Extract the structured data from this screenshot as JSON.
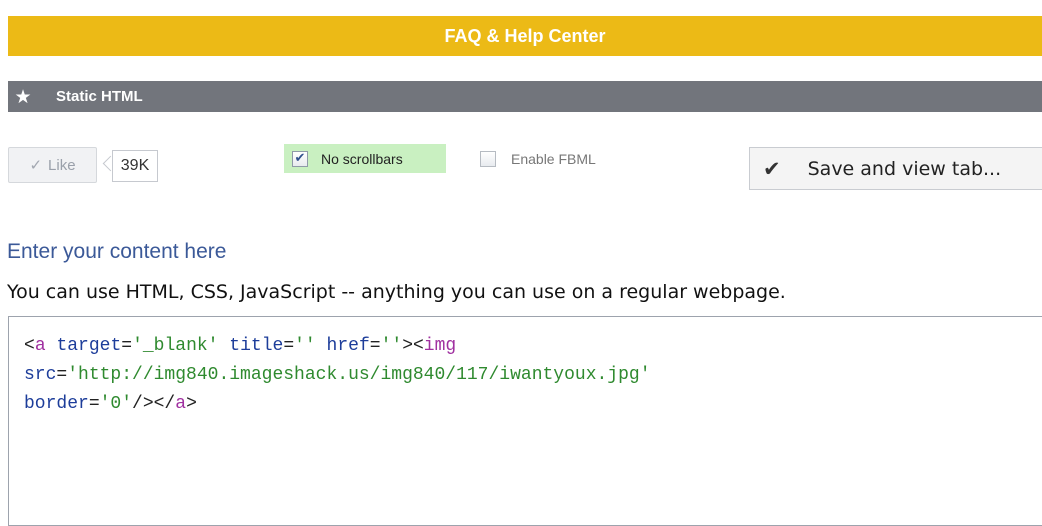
{
  "header": {
    "title": "FAQ & Help Center"
  },
  "app_bar": {
    "icon": "star-icon",
    "title": "Static HTML"
  },
  "like": {
    "label": "Like",
    "count": "39K"
  },
  "options": {
    "no_scrollbars": {
      "label": "No scrollbars",
      "checked": true
    },
    "enable_fbml": {
      "label": "Enable FBML",
      "checked": false
    }
  },
  "save_button": {
    "label": "Save and view tab..."
  },
  "content": {
    "heading": "Enter your content here",
    "help": "You can use HTML, CSS, JavaScript -- anything you can use on a regular webpage."
  },
  "code": {
    "open": "<",
    "tag_a": "a",
    "attr_target": "target",
    "eq": "=",
    "val_target": "'_blank'",
    "attr_title": "title",
    "val_title": "''",
    "attr_href": "href",
    "val_href": "''",
    "gt_lt": "><",
    "tag_img": "img",
    "attr_src": "src",
    "val_src": "'http://img840.imageshack.us/img840/117/iwantyoux.jpg'",
    "attr_border": "border",
    "val_border": "'0'",
    "self_close": "/></",
    "close": ">"
  },
  "colors": {
    "header_bg": "#ecba16",
    "app_bar_bg": "#72757c",
    "highlight_bg": "#c9f0c1",
    "heading_text": "#3b5998"
  }
}
